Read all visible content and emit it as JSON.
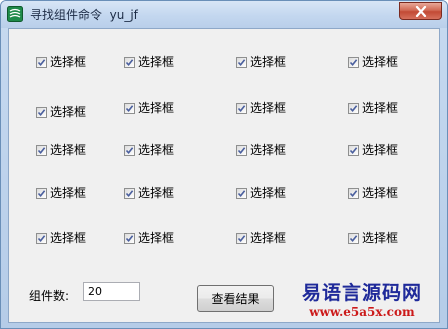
{
  "window": {
    "title": "寻找组件命令  yu_jf"
  },
  "checkboxes": [
    {
      "label": "选择框",
      "checked": true
    },
    {
      "label": "选择框",
      "checked": true
    },
    {
      "label": "选择框",
      "checked": true
    },
    {
      "label": "选择框",
      "checked": true
    },
    {
      "label": "选择框",
      "checked": true
    },
    {
      "label": "选择框",
      "checked": true
    },
    {
      "label": "选择框",
      "checked": true
    },
    {
      "label": "选择框",
      "checked": true
    },
    {
      "label": "选择框",
      "checked": true
    },
    {
      "label": "选择框",
      "checked": true
    },
    {
      "label": "选择框",
      "checked": true
    },
    {
      "label": "选择框",
      "checked": true
    },
    {
      "label": "选择框",
      "checked": true
    },
    {
      "label": "选择框",
      "checked": true
    },
    {
      "label": "选择框",
      "checked": true
    },
    {
      "label": "选择框",
      "checked": true
    },
    {
      "label": "选择框",
      "checked": true
    },
    {
      "label": "选择框",
      "checked": true
    },
    {
      "label": "选择框",
      "checked": true
    },
    {
      "label": "选择框",
      "checked": true
    }
  ],
  "footer": {
    "count_label": "组件数:",
    "count_value": "20",
    "view_result_button": "查看结果"
  },
  "watermark": {
    "title": "易语言源码网",
    "url": "www.e5a5x.com"
  },
  "colors": {
    "titlebar": "#c3d7ef",
    "client": "#f0f0f0",
    "close_button": "#c24a35",
    "watermark_title": "#1f2a9a",
    "watermark_url": "#cc1a1a"
  },
  "icons": {
    "app": "app-logo-icon",
    "close": "close-icon",
    "check": "checkmark-icon"
  }
}
